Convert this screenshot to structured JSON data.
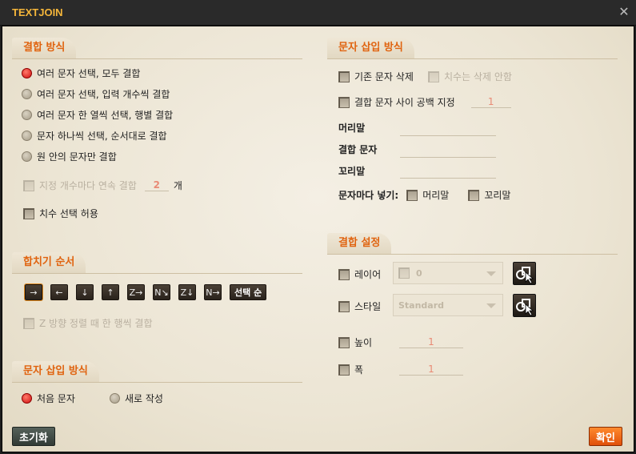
{
  "window": {
    "title": "TEXTJOIN",
    "close_glyph": "✕"
  },
  "join_method": {
    "title": "결합 방식",
    "options": [
      "여러 문자 선택, 모두 결합",
      "여러 문자 선택, 입력 개수씩 결합",
      "여러 문자 한 열씩 선택, 행별 결합",
      "문자 하나씩 선택, 순서대로 결합",
      "원 안의 문자만 결합"
    ],
    "selected_index": 0,
    "per_count_label": "지정 개수마다 연속 결합",
    "per_count_value": "2",
    "per_count_unit": "개",
    "allow_dimension_label": "치수 선택 허용"
  },
  "merge_order": {
    "title": "합치기 순서",
    "direction_buttons": [
      "→",
      "←",
      "↓",
      "↑",
      "Z→",
      "N↘",
      "Z↓",
      "N→"
    ],
    "direction_icons": [
      "arrow-right-icon",
      "arrow-left-icon",
      "arrow-down-icon",
      "arrow-up-icon",
      "z-horizontal-icon",
      "n-horizontal-icon",
      "z-vertical-icon",
      "n-vertical-icon"
    ],
    "selection_order_label": "선택 순",
    "z_row_join_label": "Z 방향 정렬 때 한 행씩 결합"
  },
  "insert_method_left": {
    "title": "문자 삽입 방식",
    "options": [
      "처음 문자",
      "새로 작성"
    ],
    "selected_index": 0
  },
  "insert_method_right": {
    "title": "문자 삽입 방식",
    "delete_original_label": "기존 문자 삭제",
    "keep_dimension_label": "치수는 삭제 안함",
    "space_label": "결합 문자 사이 공백 지정",
    "space_value": "1",
    "prefix_label": "머리말",
    "join_char_label": "결합 문자",
    "suffix_label": "꼬리말",
    "per_char_label": "문자마다 넣기:",
    "per_char_prefix_label": "머리말",
    "per_char_suffix_label": "꼬리말"
  },
  "join_settings": {
    "title": "결합 설정",
    "layer_label": "레이어",
    "layer_value": "0",
    "style_label": "스타일",
    "style_value": "Standard",
    "height_label": "높이",
    "height_value": "1",
    "width_label": "폭",
    "width_value": "1"
  },
  "footer": {
    "reset_label": "초기화",
    "ok_label": "확인"
  },
  "colors": {
    "accent": "#e0630f",
    "title": "#f5b63a",
    "ok_button": "#f26a10",
    "reset_button": "#3f4a44"
  }
}
